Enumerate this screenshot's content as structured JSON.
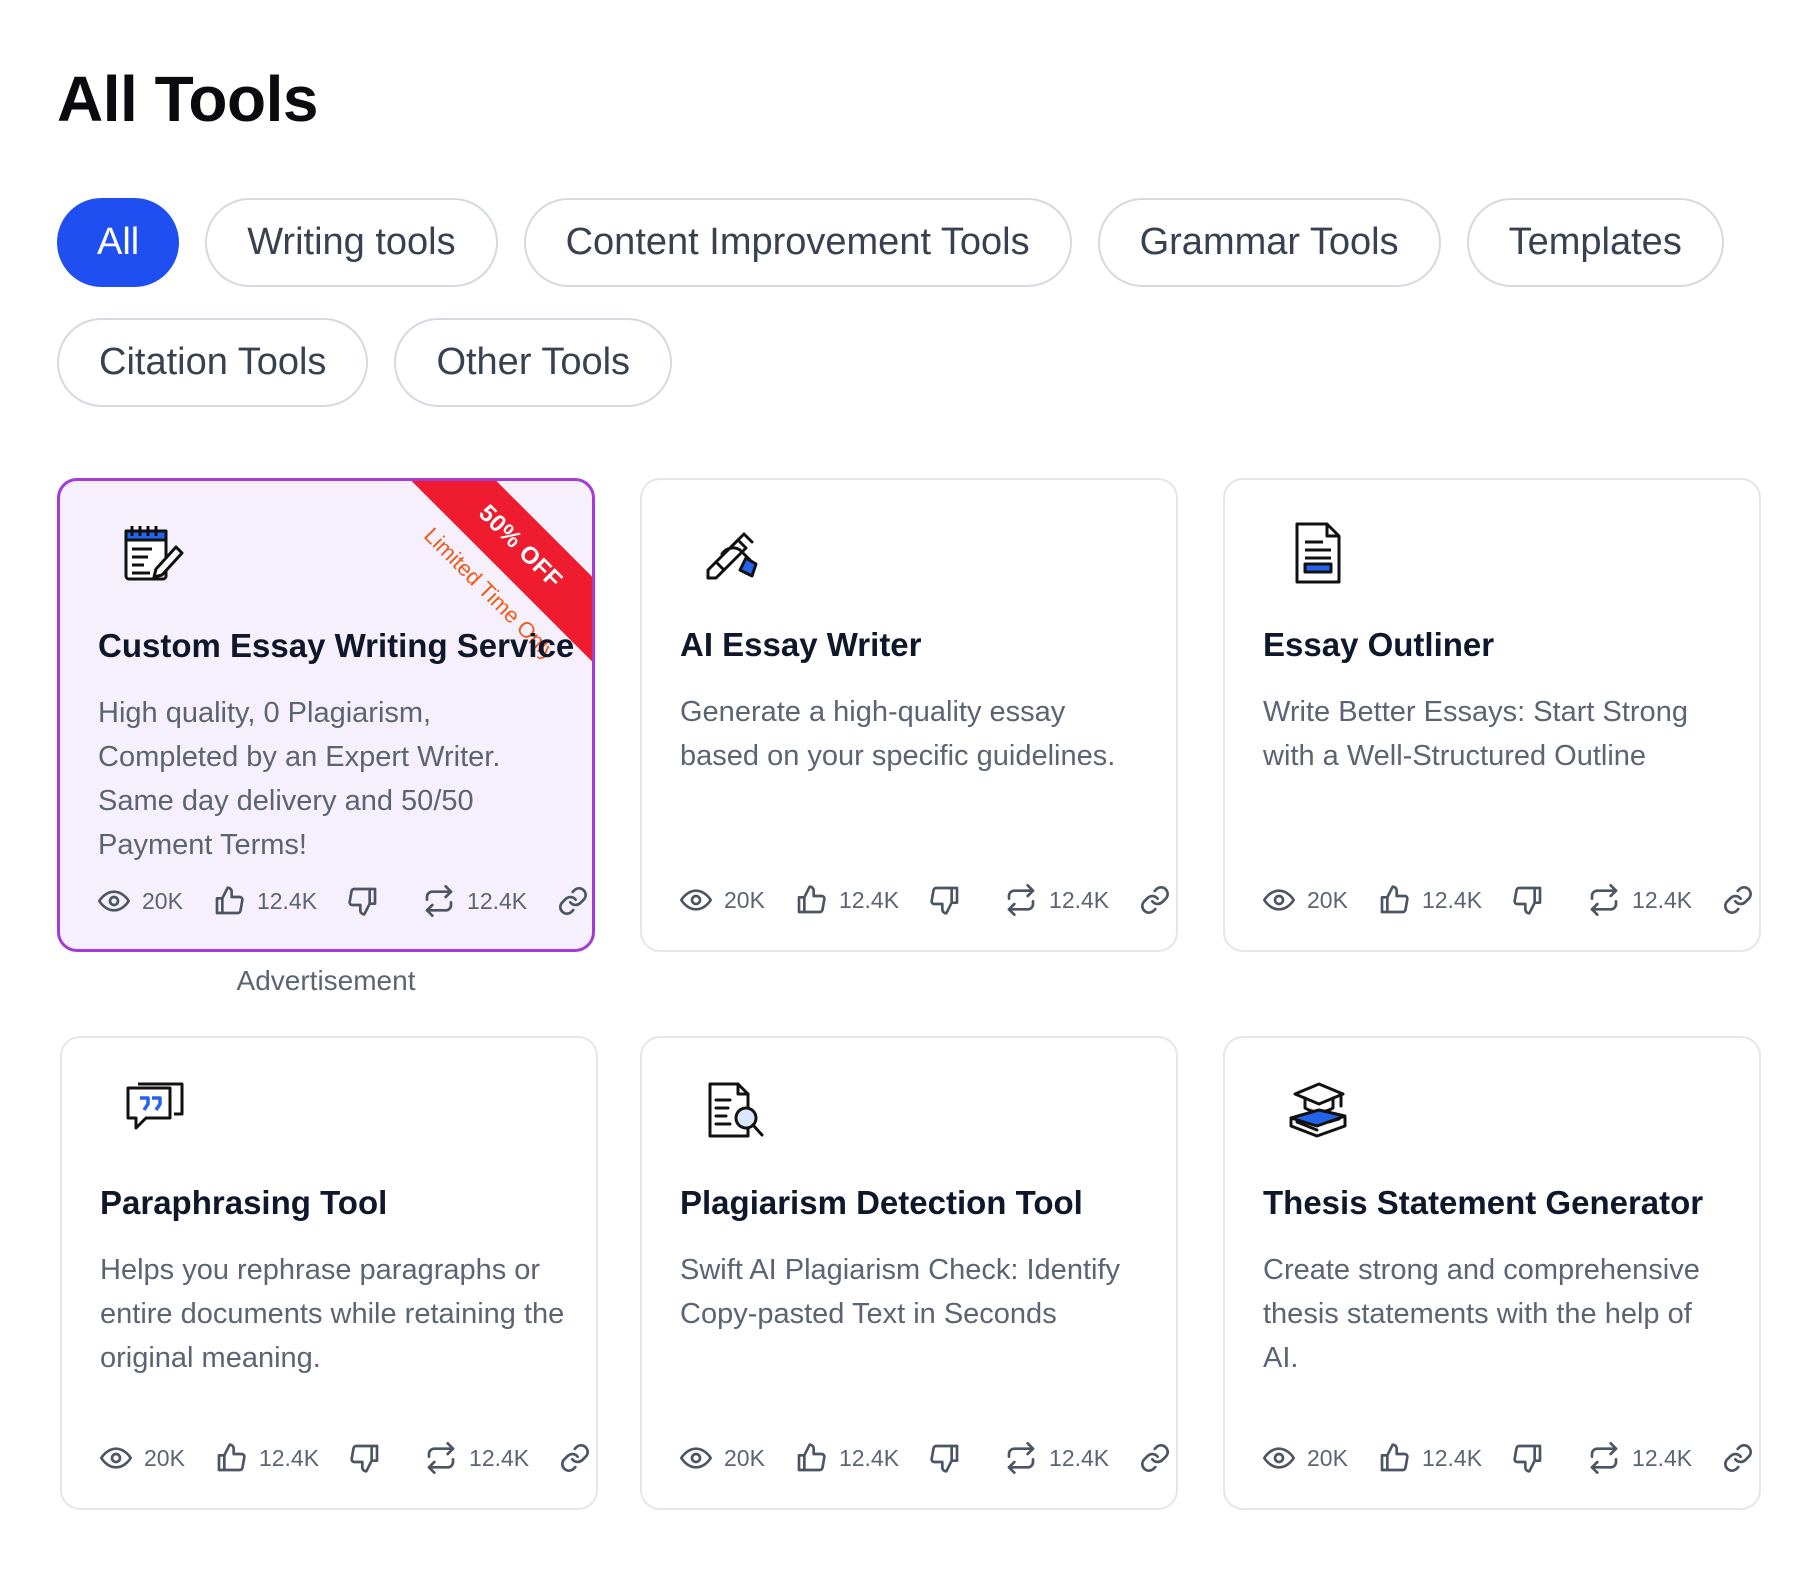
{
  "page": {
    "title": "All Tools"
  },
  "filters": {
    "row1": [
      "All",
      "Writing tools",
      "Content Improvement Tools",
      "Grammar Tools",
      "Templates"
    ],
    "row2": [
      "Citation Tools",
      "Other Tools"
    ],
    "active": "All"
  },
  "colors": {
    "accent": "#1f4ff0",
    "ad_border": "#a63ad6",
    "ad_bg": "#f6f0fd",
    "ribbon": "#ee1c2e",
    "ribbon_sub": "#ef5a1a"
  },
  "cards": [
    {
      "title": "Custom Essay Writing Service",
      "desc": "High quality, 0 Plagiarism, Completed by an Expert Writer. Same day delivery and 50/50 Payment Terms!",
      "icon": "notepad-pencil-icon",
      "views": "20K",
      "likes": "12.4K",
      "shares": "12.4K",
      "ribbon": "50% OFF",
      "ribbon_sub": "Limited Time Only",
      "ad_label": "Advertisement"
    },
    {
      "title": "AI Essay Writer",
      "desc": "Generate a high-quality essay based on your specific guidelines.",
      "icon": "hand-writing-icon",
      "views": "20K",
      "likes": "12.4K",
      "shares": "12.4K"
    },
    {
      "title": "Essay Outliner",
      "desc": "Write Better Essays: Start Strong with a Well-Structured Outline",
      "icon": "document-outline-icon",
      "views": "20K",
      "likes": "12.4K",
      "shares": "12.4K"
    },
    {
      "title": "Paraphrasing Tool",
      "desc": "Helps you rephrase paragraphs or entire documents while retaining the original meaning.",
      "icon": "quote-bubble-icon",
      "views": "20K",
      "likes": "12.4K",
      "shares": "12.4K"
    },
    {
      "title": "Plagiarism Detection Tool",
      "desc": "Swift AI Plagiarism Check: Identify Copy-pasted Text in Seconds",
      "icon": "document-search-icon",
      "views": "20K",
      "likes": "12.4K",
      "shares": "12.4K"
    },
    {
      "title": "Thesis Statement Generator",
      "desc": "Create strong and comprehensive thesis statements with the help of AI.",
      "icon": "graduation-book-icon",
      "views": "20K",
      "likes": "12.4K",
      "shares": "12.4K"
    }
  ]
}
